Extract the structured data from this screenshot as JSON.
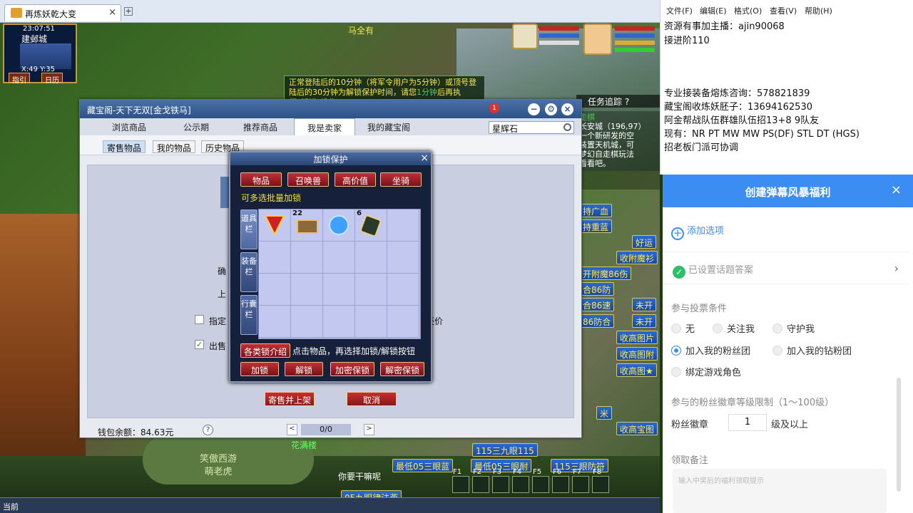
{
  "browser": {
    "tab_title": "再炼妖乾大变",
    "add": "+"
  },
  "game": {
    "time": "23:07:51",
    "city": "建邺城",
    "coords": "X:49 Y:35",
    "guide": "指引",
    "calendar": "日历",
    "announce_pre": "正常登陆后的10分钟（将军令用户为5分钟）或顶号登陆后的30分钟为解锁保护时间，请您",
    "announce_hl": "1分钟",
    "announce_post": "后再执行“解锁”操作。",
    "npc_name": "马全有",
    "quest_label": "任务追踪",
    "chat": [
      "走棋",
      "长安城（196,97）",
      "一个新研发的空",
      "装置天机城，可",
      "梦幻自走棋玩法",
      "看看吧。"
    ],
    "ads": [
      "持广血",
      "持重蓝",
      "好运",
      "收附魔衫",
      "开附魔86伤",
      "合86防",
      "合86速",
      "未开",
      "86防合",
      "未开",
      "收高图片",
      "收高图附",
      "收高图★",
      "米",
      "收高宝图",
      "115三九眼115",
      "最低05三眼蓝",
      "最低05三眼耐",
      "115三眼防符",
      "05九眼律法燕"
    ],
    "stone_text": [
      "笑傲西游",
      "萌老虎"
    ],
    "say1": "你要干嘛呢",
    "say2": "花满楼",
    "fkeys": [
      "F1",
      "F2",
      "F3",
      "F4",
      "F5",
      "F6",
      "F7",
      "F8"
    ],
    "bottom_label": "当前"
  },
  "shop": {
    "title": "藏宝阁-天下无双[金戈铁马]",
    "search_value": "星辉石",
    "badge": "1",
    "nav_tabs": [
      "浏览商品",
      "公示期",
      "推荐商品",
      "我是卖家",
      "我的藏宝阁"
    ],
    "sub_tabs": [
      "寄售物品",
      "我的物品",
      "历史物品"
    ],
    "ghost_labels": {
      "confirm": "确",
      "up": "上",
      "specify": "指定",
      "price_suffix": "还价",
      "sale": "出售"
    },
    "wallet_label": "钱包余额：",
    "wallet_value": "84.63元",
    "help": "?",
    "page": "0/0",
    "prev": "<",
    "next": ">",
    "submit": "寄售并上架",
    "cancel": "取消"
  },
  "lock": {
    "title": "加锁保护",
    "close": "×",
    "categories": [
      "物品",
      "召唤兽",
      "高价值",
      "坐骑"
    ],
    "batch_hint": "可多选批量加锁",
    "side_tabs": [
      "道具栏",
      "装备栏",
      "行囊栏"
    ],
    "items": [
      {
        "name": "红扇",
        "qty": ""
      },
      {
        "name": "书卷",
        "qty": "22"
      },
      {
        "name": "蓝珠",
        "qty": ""
      },
      {
        "name": "卷轴",
        "qty": "6"
      }
    ],
    "intro_btn": "各类锁介绍",
    "intro_hint": "点击物品，再选择加锁/解锁按钮",
    "actions": [
      "加锁",
      "解锁",
      "加密保锁",
      "解密保锁"
    ]
  },
  "notepad": {
    "menu": [
      "文件(F)",
      "编辑(E)",
      "格式(O)",
      "查看(V)",
      "帮助(H)"
    ],
    "lines": [
      "资源有事加主播：ajin90068",
      "接进阶110",
      "",
      "",
      "专业接装备熔炼咨询：578821839",
      "藏宝阁收炼妖胚子：13694162530",
      "阿金帮战队伍群雄队伍招13+8 9队友",
      "现有：NR PT MW MW PS(DF)  STL  DT  (HGS)",
      "招老板门派可协调"
    ]
  },
  "panel": {
    "title": "创建弹幕风暴福利",
    "close": "×",
    "add_option": "添加选项",
    "answer_set": "已设置话题答案",
    "cond_label": "参与投票条件",
    "cond_options": [
      {
        "label": "无",
        "selected": false
      },
      {
        "label": "关注我",
        "selected": false
      },
      {
        "label": "守护我",
        "selected": false
      },
      {
        "label": "加入我的粉丝团",
        "selected": true
      },
      {
        "label": "加入我的钻粉团",
        "selected": false
      },
      {
        "label": "绑定游戏角色",
        "selected": false
      }
    ],
    "level_label": "参与的粉丝徽章等级限制（1～100级）",
    "badge_label": "粉丝徽章",
    "badge_value": "1",
    "badge_suffix": "级及以上",
    "note_label": "领取备注",
    "note_placeholder": "输入中奖后的福利领取提示"
  },
  "colors": {
    "accent": "#3c8df3",
    "game_red": "#c03038",
    "notice_yellow": "#f7e94a"
  }
}
